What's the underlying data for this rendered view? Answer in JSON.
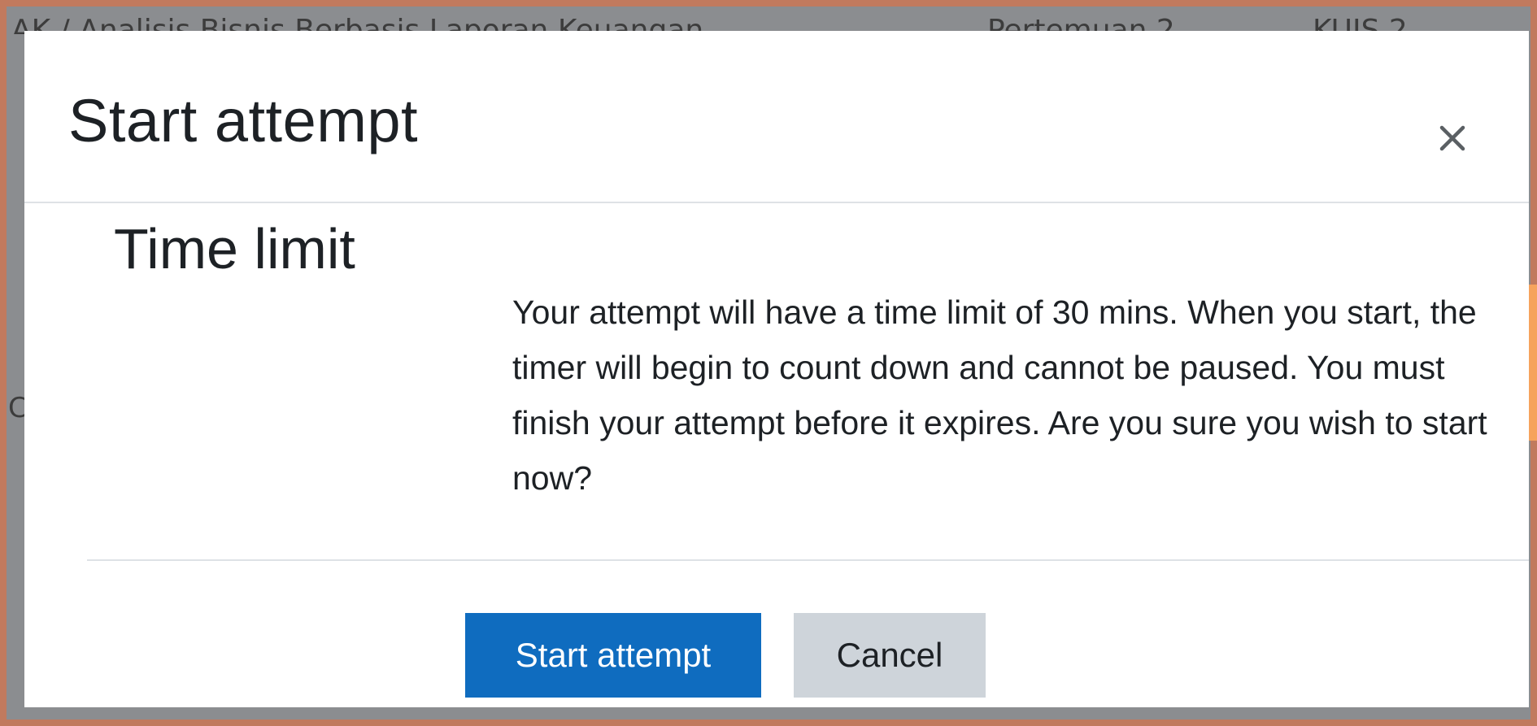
{
  "background": {
    "breadcrumb_course": "AK / Analisis Bisnis Berbasis Laporan Keuangan",
    "breadcrumb_meeting": "Pertemuan 2",
    "breadcrumb_quiz": "KUIS 2",
    "left_letter": "C"
  },
  "modal": {
    "title": "Start attempt",
    "close_symbol": "close-icon",
    "section_heading": "Time limit",
    "message": "Your attempt will have a time limit of 30 mins. When you start, the timer will begin to count down and cannot be paused. You must finish your attempt before it expires. Are you sure you wish to start now?",
    "buttons": {
      "start_label": "Start attempt",
      "cancel_label": "Cancel"
    }
  },
  "colors": {
    "primary": "#0f6cbf",
    "secondary": "#ced4da",
    "frame": "#c17a5e",
    "accent_orange": "#f6a35d"
  }
}
